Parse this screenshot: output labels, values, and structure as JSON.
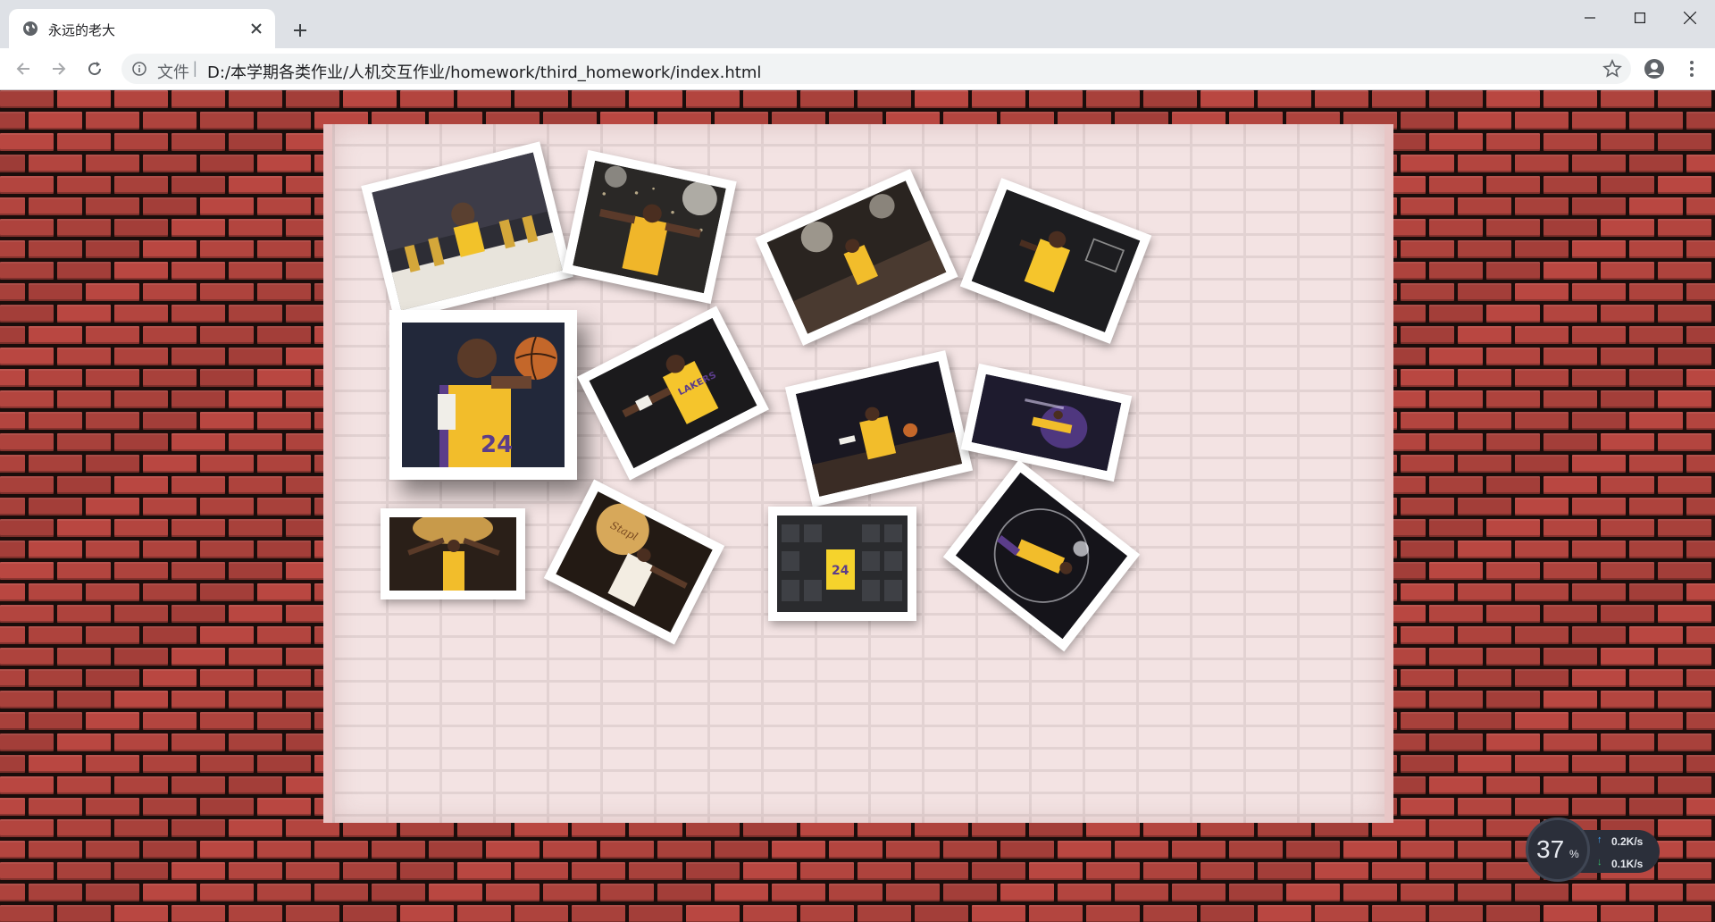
{
  "tab": {
    "title": "永远的老大",
    "favicon": "globe-icon",
    "close_icon": "close-icon"
  },
  "window_controls": [
    "minimize-icon",
    "maximize-icon",
    "close-icon"
  ],
  "addressbar": {
    "scheme_label": "文件",
    "separator": "|",
    "url": "D:/本学期各类作业/人机交互作业/homework/third_homework/index.html"
  },
  "colors": {
    "brick": "#b94741",
    "mortar": "#1a0d0b",
    "board": "#f3e3e3",
    "frame": "#ffffff"
  },
  "photos": [
    {
      "name": "photo-trophies",
      "desc": "Kobe with championship trophies",
      "featured": false
    },
    {
      "name": "photo-confetti-back",
      "desc": "Kobe back view under confetti, Bryant 24",
      "featured": false
    },
    {
      "name": "photo-celebration-crouch",
      "desc": "Kobe crouching in confetti",
      "featured": false
    },
    {
      "name": "photo-number-8-pose",
      "desc": "Kobe in number jersey",
      "featured": false
    },
    {
      "name": "photo-shooting-pose",
      "desc": "Kobe holding basketball ready to shoot",
      "featured": true
    },
    {
      "name": "photo-arm-extended",
      "desc": "Kobe Lakers 24 arm extended",
      "featured": false
    },
    {
      "name": "photo-dribble",
      "desc": "Kobe dribbling on court",
      "featured": false
    },
    {
      "name": "photo-purple-tribute",
      "desc": "Kobe tribute wallpaper",
      "featured": false
    },
    {
      "name": "photo-arms-wide",
      "desc": "Kobe arms wide in arena",
      "featured": false
    },
    {
      "name": "photo-staples-center",
      "desc": "Kobe arms spread Staples Center",
      "featured": false
    },
    {
      "name": "photo-empty-seats",
      "desc": "Jersey on empty arena seats",
      "featured": false
    },
    {
      "name": "photo-fisheye-layup",
      "desc": "Kobe layup fisheye view",
      "featured": false
    }
  ],
  "speed_widget": {
    "cpu_percent": "37",
    "percent_sign": "%",
    "upload": "0.2K/s",
    "download": "0.1K/s",
    "upload_icon": "arrow-up-icon",
    "download_icon": "arrow-down-icon"
  }
}
